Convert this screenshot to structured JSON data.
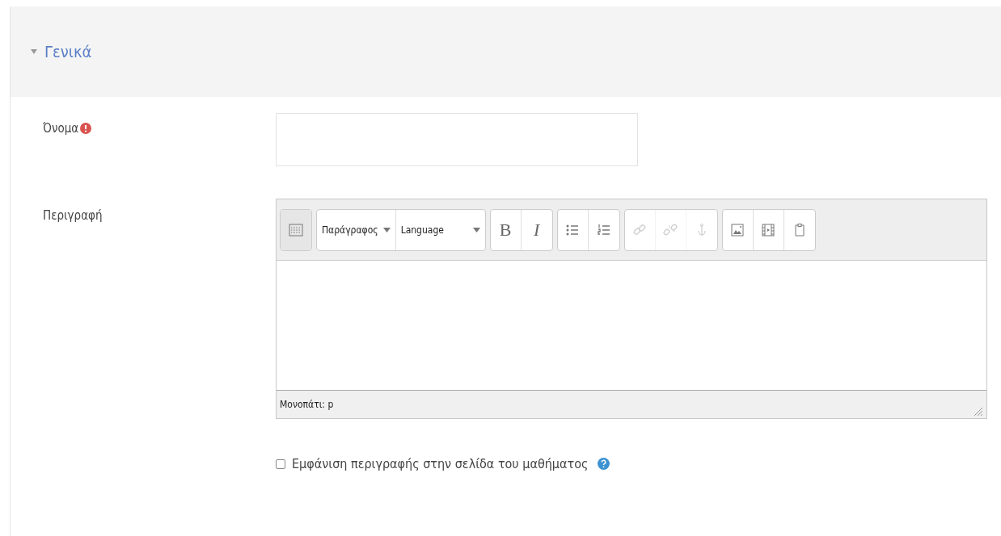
{
  "section": {
    "title": "Γενικά",
    "expanded": true
  },
  "name_field": {
    "label": "Όνομα",
    "required": true
  },
  "description": {
    "label": "Περιγραφή",
    "toolbar": [
      {
        "items": [
          {
            "kind": "collapse",
            "disabled": false
          }
        ]
      },
      {
        "items": [
          {
            "kind": "dropdown",
            "label": "Παράγραφος",
            "disabled": false
          },
          {
            "kind": "dropdown",
            "label": "Language",
            "disabled": false
          }
        ]
      },
      {
        "items": [
          {
            "kind": "bold",
            "label": "B",
            "disabled": false
          },
          {
            "kind": "italic",
            "label": "I",
            "disabled": false
          }
        ]
      },
      {
        "items": [
          {
            "kind": "bullets",
            "disabled": false
          },
          {
            "kind": "numbers",
            "disabled": false
          }
        ]
      },
      {
        "items": [
          {
            "kind": "link",
            "disabled": true
          },
          {
            "kind": "unlink",
            "disabled": true
          },
          {
            "kind": "anchor",
            "disabled": true
          }
        ]
      },
      {
        "items": [
          {
            "kind": "image",
            "disabled": false
          },
          {
            "kind": "media",
            "disabled": false
          },
          {
            "kind": "paste",
            "disabled": false
          }
        ]
      }
    ],
    "path": "Μονοπάτι: p"
  },
  "show_description": {
    "label": "Εμφάνιση περιγραφής στην σελίδα του μαθήματος",
    "checked": false
  }
}
